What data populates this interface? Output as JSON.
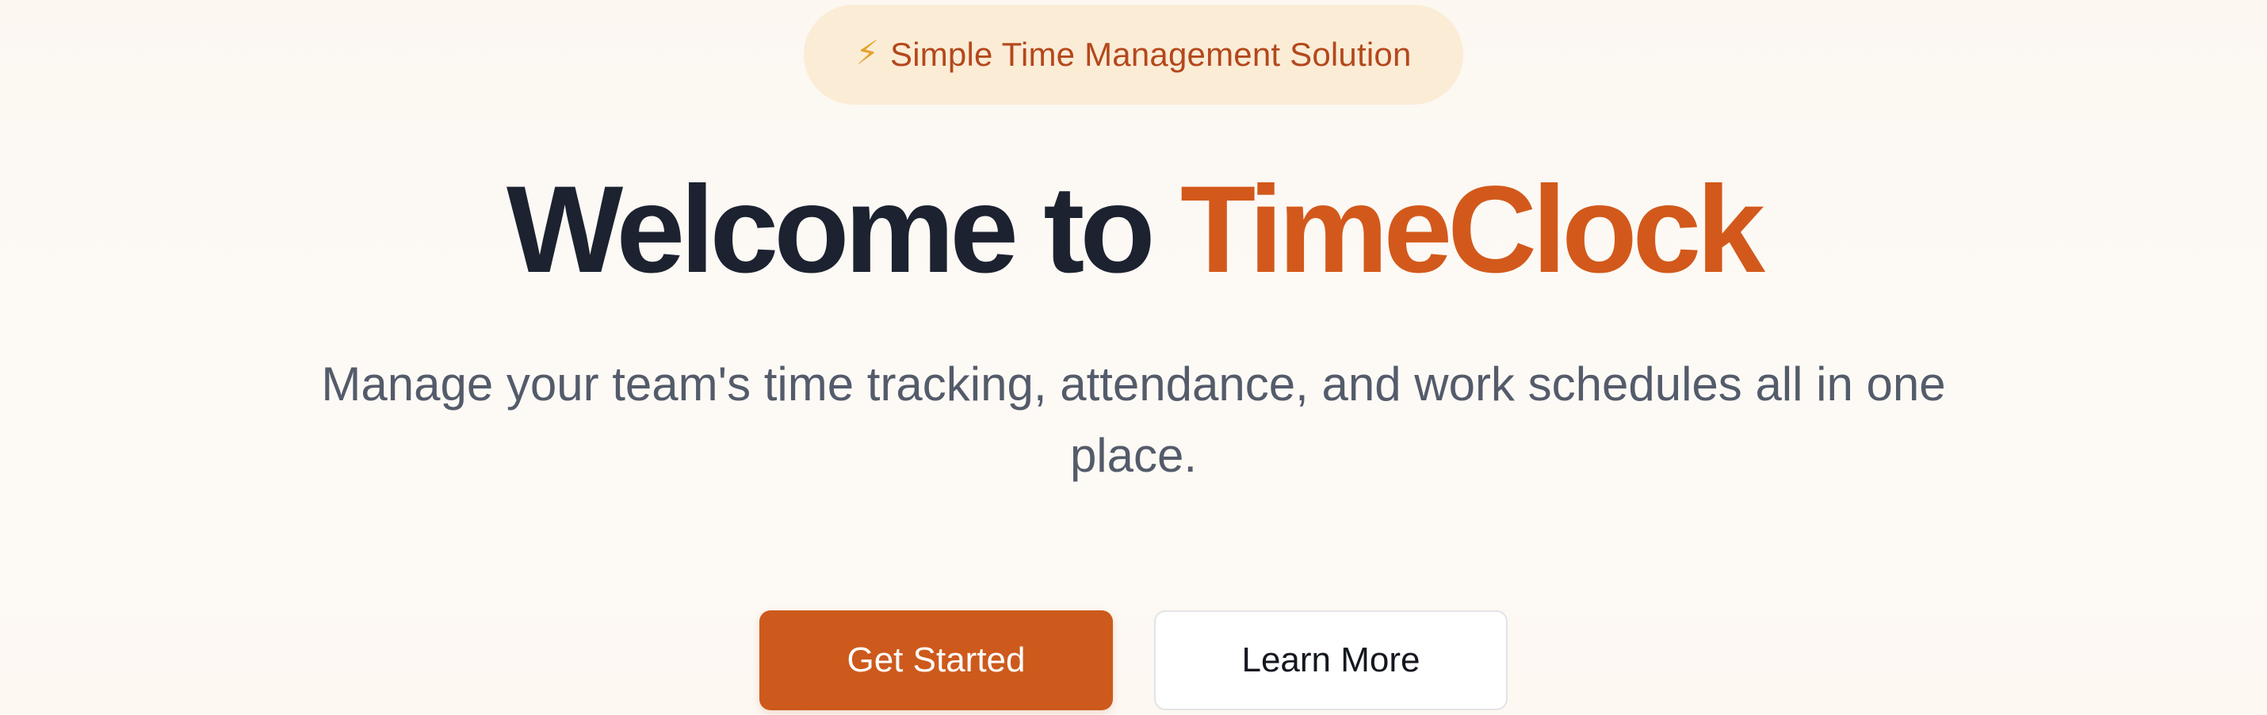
{
  "badge": {
    "icon": "lightning-bolt-icon",
    "icon_glyph": "⚡",
    "label": "Simple Time Management Solution"
  },
  "hero": {
    "title_prefix": "Welcome to ",
    "title_brand": "TimeClock",
    "subtitle": "Manage your team's time tracking, attendance, and work schedules all in one place."
  },
  "actions": {
    "primary_label": "Get Started",
    "secondary_label": "Learn More"
  },
  "colors": {
    "brand": "#d2591b",
    "primary_button": "#cd5a1c",
    "badge_background": "#fbecd6",
    "badge_text": "#b4481c",
    "heading": "#1c2230",
    "body_text": "#545b6a"
  }
}
